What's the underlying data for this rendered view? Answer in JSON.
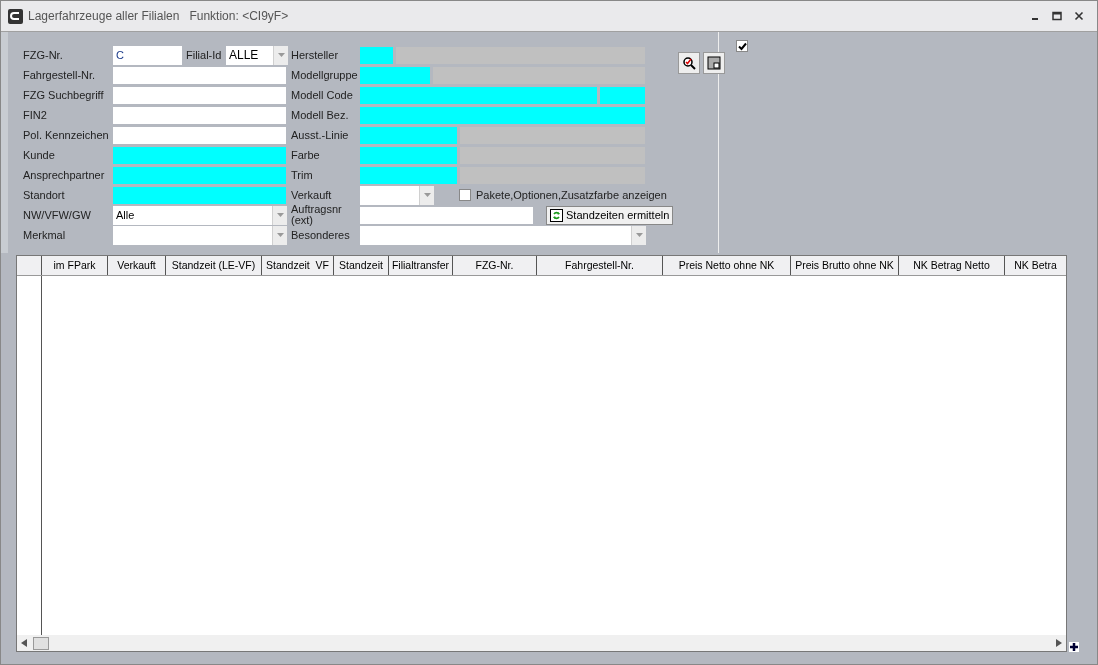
{
  "window": {
    "title": "Lagerfahrzeuge aller Filialen",
    "function": "Funktion: <CI9yF>"
  },
  "left_fields": [
    {
      "label": "FZG-Nr.",
      "kind": "fzg",
      "value": "C",
      "extra_label": "Filial-Id",
      "extra_value": "ALLE"
    },
    {
      "label": "Fahrgestell-Nr.",
      "kind": "text"
    },
    {
      "label": "FZG Suchbegriff",
      "kind": "text"
    },
    {
      "label": "FIN2",
      "kind": "text"
    },
    {
      "label": "Pol. Kennzeichen",
      "kind": "text"
    },
    {
      "label": "Kunde",
      "kind": "cyan"
    },
    {
      "label": "Ansprechpartner",
      "kind": "cyan"
    },
    {
      "label": "Standort",
      "kind": "cyan"
    },
    {
      "label": "NW/VFW/GW",
      "kind": "combo",
      "value": "Alle"
    },
    {
      "label": "Merkmal",
      "kind": "combo"
    }
  ],
  "right_fields": [
    {
      "label": "Hersteller",
      "kind": "split"
    },
    {
      "label": "Modellgruppe",
      "kind": "split"
    },
    {
      "label": "Modell Code",
      "kind": "double"
    },
    {
      "label": "Modell Bez.",
      "kind": "cyan"
    },
    {
      "label": "Ausst.-Linie",
      "kind": "split"
    },
    {
      "label": "Farbe",
      "kind": "split"
    },
    {
      "label": "Trim",
      "kind": "split"
    },
    {
      "label": "Verkauft",
      "kind": "combo_check",
      "check_label": "Pakete,Optionen,Zusatzfarbe anzeigen",
      "checked": false
    },
    {
      "label": "Auftragsnr (ext)",
      "kind": "text_button",
      "button": "Standzeiten ermitteln"
    },
    {
      "label": "Besonderes",
      "kind": "combo"
    }
  ],
  "top_right_checkbox": {
    "checked": true
  },
  "table": {
    "columns": [
      "im FPark",
      "Verkauft",
      "Standzeit (LE-VF)",
      "Standzeit  VF",
      "Standzeit",
      "Filialtransfer",
      "FZG-Nr.",
      "Fahrgestell-Nr.",
      "Preis Netto ohne NK",
      "Preis Brutto ohne NK",
      "NK Betrag Netto",
      "NK Betra"
    ]
  }
}
